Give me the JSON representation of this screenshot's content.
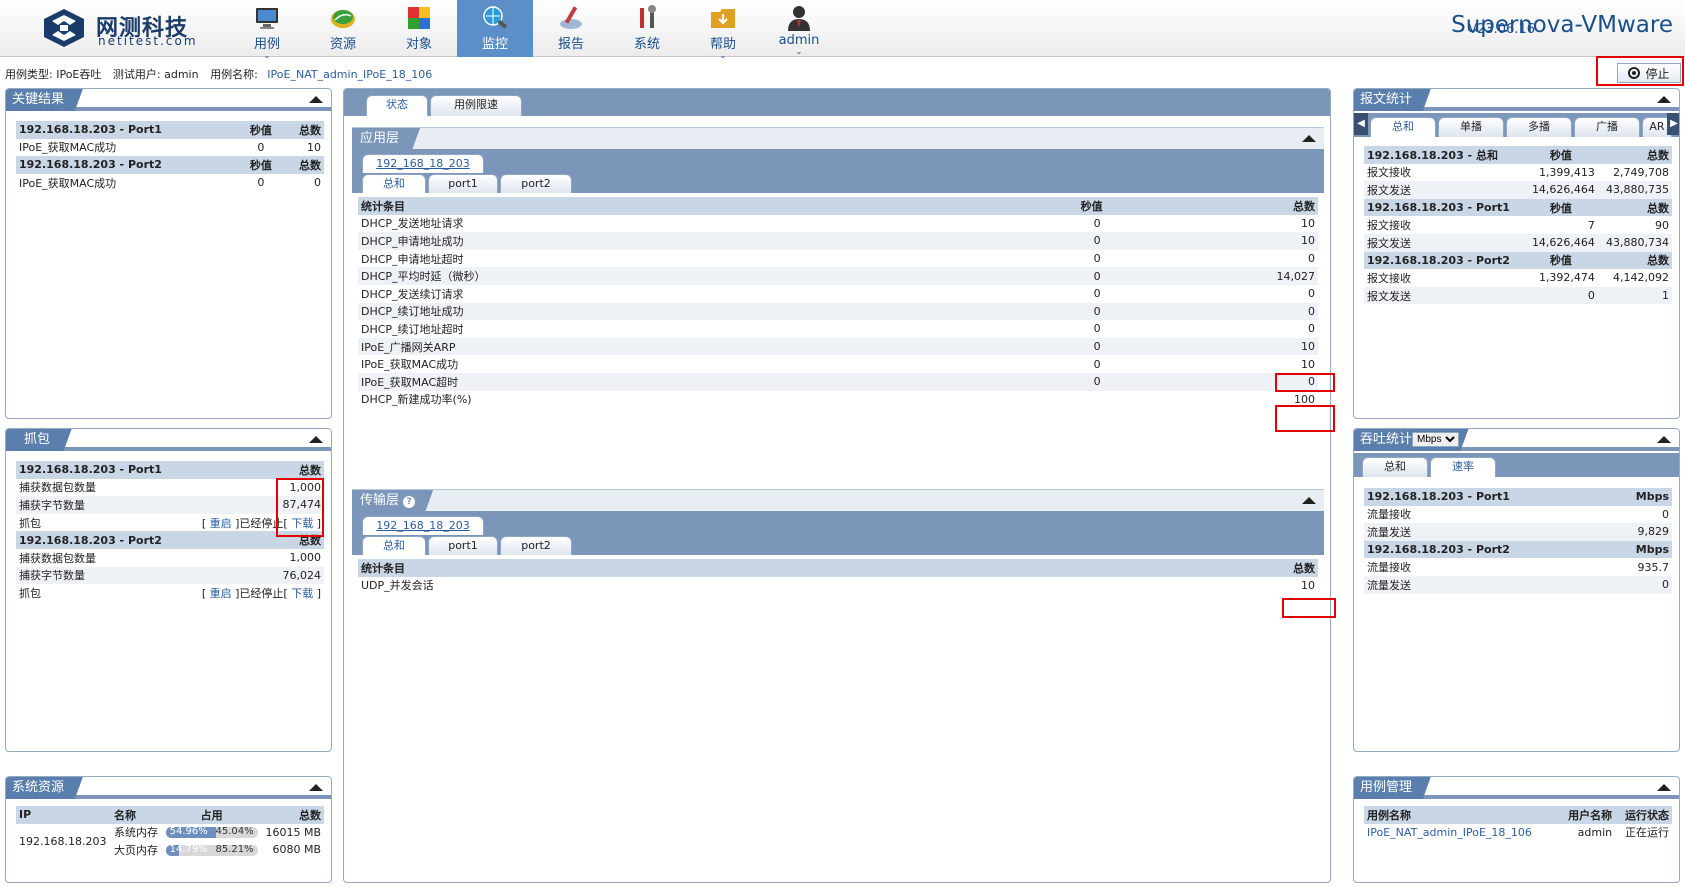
{
  "header": {
    "logo_cn": "网测科技",
    "logo_en": "netitest.com",
    "nav": [
      {
        "label": "用例",
        "icon": "monitor-icon",
        "has_menu": true
      },
      {
        "label": "资源",
        "icon": "leaf-icon",
        "has_menu": false
      },
      {
        "label": "对象",
        "icon": "blocks-icon",
        "has_menu": false
      },
      {
        "label": "监控",
        "icon": "globe-search-icon",
        "has_menu": false,
        "active": true
      },
      {
        "label": "报告",
        "icon": "report-pen-icon",
        "has_menu": false
      },
      {
        "label": "系统",
        "icon": "tools-icon",
        "has_menu": false
      },
      {
        "label": "帮助",
        "icon": "folder-download-icon",
        "has_menu": true
      },
      {
        "label": "admin",
        "icon": "user-icon",
        "has_menu": true
      }
    ],
    "version": "V23.06.16",
    "product": "Supernova-VMware"
  },
  "infobar": {
    "type_label": "用例类型:",
    "type_value": "IPoE吞吐",
    "user_label": "测试用户:",
    "user_value": "admin",
    "name_label": "用例名称:",
    "name_value": "IPoE_NAT_admin_IPoE_18_106",
    "stop_label": "停止"
  },
  "key_results": {
    "title": "关键结果",
    "groups": [
      {
        "head": "192.168.18.203 - Port1",
        "col1": "秒值",
        "col2": "总数",
        "rows": [
          {
            "name": "IPoE_获取MAC成功",
            "sec": "0",
            "total": "10"
          }
        ]
      },
      {
        "head": "192.168.18.203 - Port2",
        "col1": "秒值",
        "col2": "总数",
        "rows": [
          {
            "name": "IPoE_获取MAC成功",
            "sec": "0",
            "total": "0"
          }
        ]
      }
    ]
  },
  "capture": {
    "title": "抓包",
    "groups": [
      {
        "head": "192.168.18.203 - Port1",
        "col": "总数",
        "packets_label": "捕获数据包数量",
        "packets": "1,000",
        "bytes_label": "捕获字节数量",
        "bytes": "87,474",
        "cap_label": "抓包",
        "restart": "重启",
        "state": "已经停止",
        "download": "下载"
      },
      {
        "head": "192.168.18.203 - Port2",
        "col": "总数",
        "packets_label": "捕获数据包数量",
        "packets": "1,000",
        "bytes_label": "捕获字节数量",
        "bytes": "76,024",
        "cap_label": "抓包",
        "restart": "重启",
        "state": "已经停止",
        "download": "下载"
      }
    ]
  },
  "sysres": {
    "title": "系统资源",
    "headers": [
      "IP",
      "名称",
      "占用",
      "总数"
    ],
    "ip": "192.168.18.203",
    "rows": [
      {
        "name": "系统内存",
        "used": 54.96,
        "used_label": "54.96%",
        "free_label": "45.04%",
        "total": "16015 MB"
      },
      {
        "name": "大页内存",
        "used": 14.79,
        "used_label": "14.79%",
        "free_label": "85.21%",
        "total": "6080 MB"
      }
    ]
  },
  "center": {
    "tabs": [
      "状态",
      "用例限速"
    ],
    "app": {
      "title": "应用层",
      "host_tab": "192_168_18_203",
      "tabs": [
        "总和",
        "port1",
        "port2"
      ],
      "headers": [
        "统计条目",
        "秒值",
        "总数"
      ],
      "rows": [
        {
          "name": "DHCP_发送地址请求",
          "sec": "0",
          "total": "10"
        },
        {
          "name": "DHCP_申请地址成功",
          "sec": "0",
          "total": "10"
        },
        {
          "name": "DHCP_申请地址超时",
          "sec": "0",
          "total": "0"
        },
        {
          "name": "DHCP_平均时延（微秒）",
          "sec": "0",
          "total": "14,027"
        },
        {
          "name": "DHCP_发送续订请求",
          "sec": "0",
          "total": "0"
        },
        {
          "name": "DHCP_续订地址成功",
          "sec": "0",
          "total": "0"
        },
        {
          "name": "DHCP_续订地址超时",
          "sec": "0",
          "total": "0"
        },
        {
          "name": "IPoE_广播网关ARP",
          "sec": "0",
          "total": "10"
        },
        {
          "name": "IPoE_获取MAC成功",
          "sec": "0",
          "total": "10"
        },
        {
          "name": "IPoE_获取MAC超时",
          "sec": "0",
          "total": "0"
        },
        {
          "name": "DHCP_新建成功率(%)",
          "sec": "",
          "total": "100"
        }
      ]
    },
    "transport": {
      "title": "传输层",
      "host_tab": "192_168_18_203",
      "tabs": [
        "总和",
        "port1",
        "port2"
      ],
      "headers": [
        "统计条目",
        "总数"
      ],
      "rows": [
        {
          "name": "UDP_并发会话",
          "total": "10"
        }
      ]
    }
  },
  "pktstats": {
    "title": "报文统计",
    "tabs": [
      "总和",
      "单播",
      "多播",
      "广播",
      "AR"
    ],
    "groups": [
      {
        "head": "192.168.18.203 - 总和",
        "col1": "秒值",
        "col2": "总数",
        "rows": [
          {
            "name": "报文接收",
            "sec": "1,399,413",
            "total": "2,749,708"
          },
          {
            "name": "报文发送",
            "sec": "14,626,464",
            "total": "43,880,735"
          }
        ]
      },
      {
        "head": "192.168.18.203 - Port1",
        "col1": "秒值",
        "col2": "总数",
        "rows": [
          {
            "name": "报文接收",
            "sec": "7",
            "total": "90"
          },
          {
            "name": "报文发送",
            "sec": "14,626,464",
            "total": "43,880,734"
          }
        ]
      },
      {
        "head": "192.168.18.203 - Port2",
        "col1": "秒值",
        "col2": "总数",
        "rows": [
          {
            "name": "报文接收",
            "sec": "1,392,474",
            "total": "4,142,092"
          },
          {
            "name": "报文发送",
            "sec": "0",
            "total": "1"
          }
        ]
      }
    ]
  },
  "throughput": {
    "title": "吞吐统计",
    "unit": "Mbps",
    "tabs": [
      "总和",
      "速率"
    ],
    "groups": [
      {
        "head": "192.168.18.203 - Port1",
        "col": "Mbps",
        "rows": [
          {
            "name": "流量接收",
            "val": "0"
          },
          {
            "name": "流量发送",
            "val": "9,829"
          }
        ]
      },
      {
        "head": "192.168.18.203 - Port2",
        "col": "Mbps",
        "rows": [
          {
            "name": "流量接收",
            "val": "935.7"
          },
          {
            "name": "流量发送",
            "val": "0"
          }
        ]
      }
    ]
  },
  "casemgmt": {
    "title": "用例管理",
    "headers": [
      "用例名称",
      "用户名称",
      "运行状态"
    ],
    "rows": [
      {
        "name": "IPoE_NAT_admin_IPoE_18_106",
        "user": "admin",
        "status": "正在运行"
      }
    ]
  },
  "colors": {
    "accent": "#5b7fac",
    "header_fill": "#c9d6e6",
    "highlight": "#e30000",
    "link": "#2a5d9f"
  }
}
